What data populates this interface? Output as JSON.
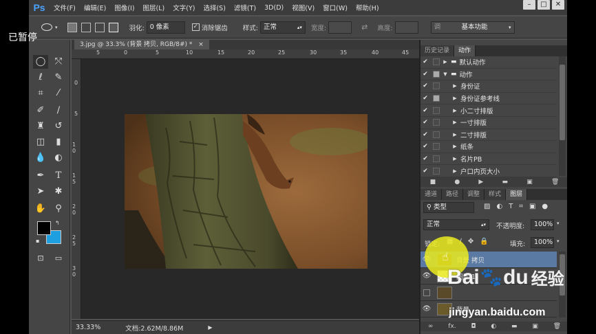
{
  "overlay": {
    "paused_label": "已暂停"
  },
  "app": {
    "logo": "Ps"
  },
  "menu": [
    "文件(F)",
    "编辑(E)",
    "图像(I)",
    "图层(L)",
    "文字(Y)",
    "选择(S)",
    "滤镜(T)",
    "3D(D)",
    "视图(V)",
    "窗口(W)",
    "帮助(H)"
  ],
  "window_controls": {
    "minimize": "–",
    "restore": "□",
    "close": "✕"
  },
  "options": {
    "feather_label": "羽化:",
    "feather_value": "0 像素",
    "antialias_label": "消除锯齿",
    "style_label": "样式:",
    "style_value": "正常",
    "width_label": "宽度:",
    "height_label": "高度:",
    "adjust_label": "调",
    "workspace_value": "基本功能"
  },
  "document": {
    "tab_title": "3.jpg @ 33.3% (背景 拷贝, RGB/8#) *",
    "close": "×",
    "ruler_top": [
      "5",
      "0",
      "5",
      "10",
      "15",
      "20",
      "25",
      "30",
      "35",
      "40",
      "45"
    ],
    "ruler_left": [
      "0",
      "5",
      "1 0",
      "1 5",
      "2 0",
      "2 5",
      "3 0"
    ],
    "zoom": "33.33%",
    "doc_info": "文档:2.62M/8.86M"
  },
  "history_panel": {
    "tabs": [
      "历史记录",
      "动作"
    ],
    "actions": [
      {
        "label": "默认动作",
        "level": 0,
        "expanded": false,
        "folder": true
      },
      {
        "label": "动作",
        "level": 0,
        "expanded": true,
        "folder": true
      },
      {
        "label": "身份证",
        "level": 1,
        "expanded": false,
        "folder": false
      },
      {
        "label": "身份证参考线",
        "level": 1,
        "expanded": false,
        "folder": false
      },
      {
        "label": "小二寸排版",
        "level": 1,
        "expanded": false,
        "folder": false
      },
      {
        "label": "一寸排版",
        "level": 1,
        "expanded": false,
        "folder": false
      },
      {
        "label": "二寸排版",
        "level": 1,
        "expanded": false,
        "folder": false
      },
      {
        "label": "纸条",
        "level": 1,
        "expanded": false,
        "folder": false
      },
      {
        "label": "名片PB",
        "level": 1,
        "expanded": false,
        "folder": false
      },
      {
        "label": "户口内页大小",
        "level": 1,
        "expanded": false,
        "folder": false
      }
    ]
  },
  "layers_panel": {
    "tabs": [
      "通道",
      "路径",
      "调整",
      "样式",
      "图层"
    ],
    "filter_value": "类型",
    "blend_value": "正常",
    "opacity_label": "不透明度:",
    "opacity_value": "100%",
    "lock_label": "锁定:",
    "fill_label": "填充:",
    "fill_value": "100%",
    "layers": [
      {
        "name": "背景 拷贝",
        "selected": true
      },
      {
        "name": "图层 1",
        "selected": false
      },
      {
        "name": "",
        "selected": false
      },
      {
        "name": "背景",
        "selected": false
      }
    ],
    "footer_fx": "fx."
  },
  "watermark": {
    "brand": "Bai",
    "brand2": "du",
    "cn": "经验",
    "url": "jingyan.baidu.com"
  },
  "colors": {
    "accent": "#2a98d6",
    "foreground": "#000000",
    "background": "#1ea0e0",
    "layer_selected": "#5a7aa3"
  }
}
